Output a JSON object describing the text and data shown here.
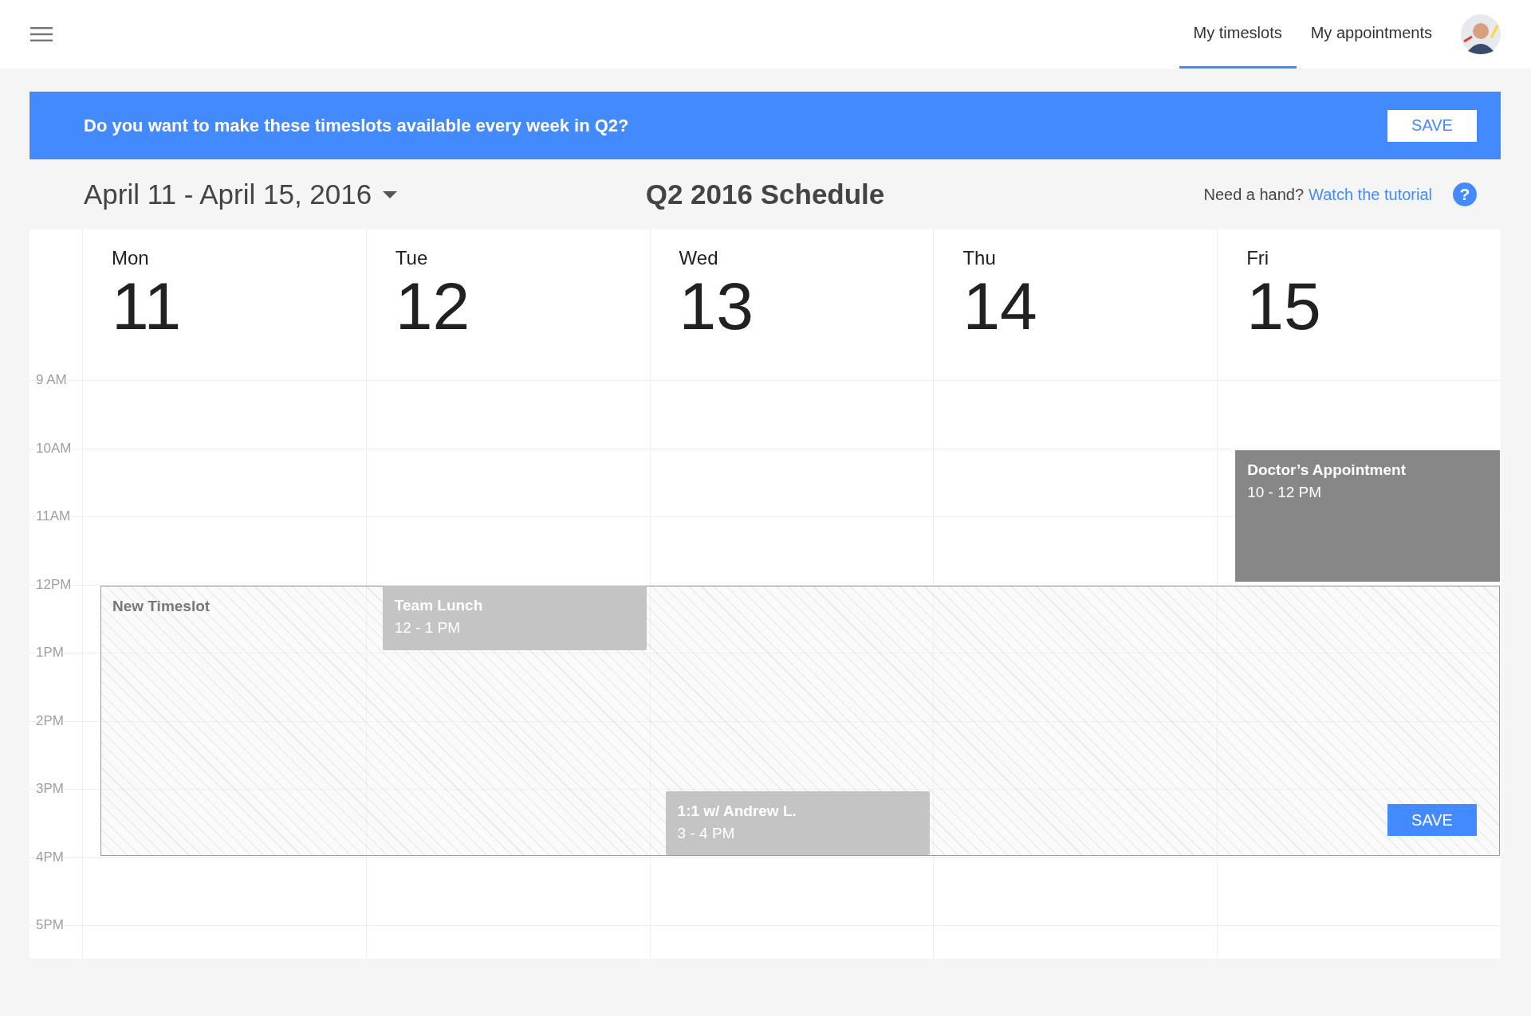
{
  "header": {
    "tabs": [
      {
        "label": "My timeslots",
        "selected": true
      },
      {
        "label": "My appointments",
        "selected": false
      }
    ]
  },
  "banner": {
    "text": "Do you want to make these timeslots available every week in Q2?",
    "button": "SAVE"
  },
  "toolbar": {
    "date_range": "April 11 - April 15, 2016",
    "title": "Q2 2016 Schedule",
    "help_text": "Need a hand?",
    "help_link": "Watch the tutorial",
    "help_icon": "?"
  },
  "calendar": {
    "days": [
      {
        "name": "Mon",
        "date": "11"
      },
      {
        "name": "Tue",
        "date": "12"
      },
      {
        "name": "Wed",
        "date": "13"
      },
      {
        "name": "Thu",
        "date": "14"
      },
      {
        "name": "Fri",
        "date": "15"
      }
    ],
    "hours": [
      "9 AM",
      "10AM",
      "11AM",
      "12PM",
      "1PM",
      "2PM",
      "3PM",
      "4PM",
      "5PM"
    ],
    "events": [
      {
        "kind": "busy",
        "title": "Doctor’s Appointment",
        "time": "10 - 12 PM"
      },
      {
        "kind": "ghost",
        "title": "Team Lunch",
        "time": "12 - 1 PM"
      },
      {
        "kind": "ghost",
        "title": "1:1 w/ Andrew L.",
        "time": "3 - 4 PM"
      }
    ],
    "new_timeslot": {
      "label": "New Timeslot",
      "button": "SAVE"
    }
  }
}
